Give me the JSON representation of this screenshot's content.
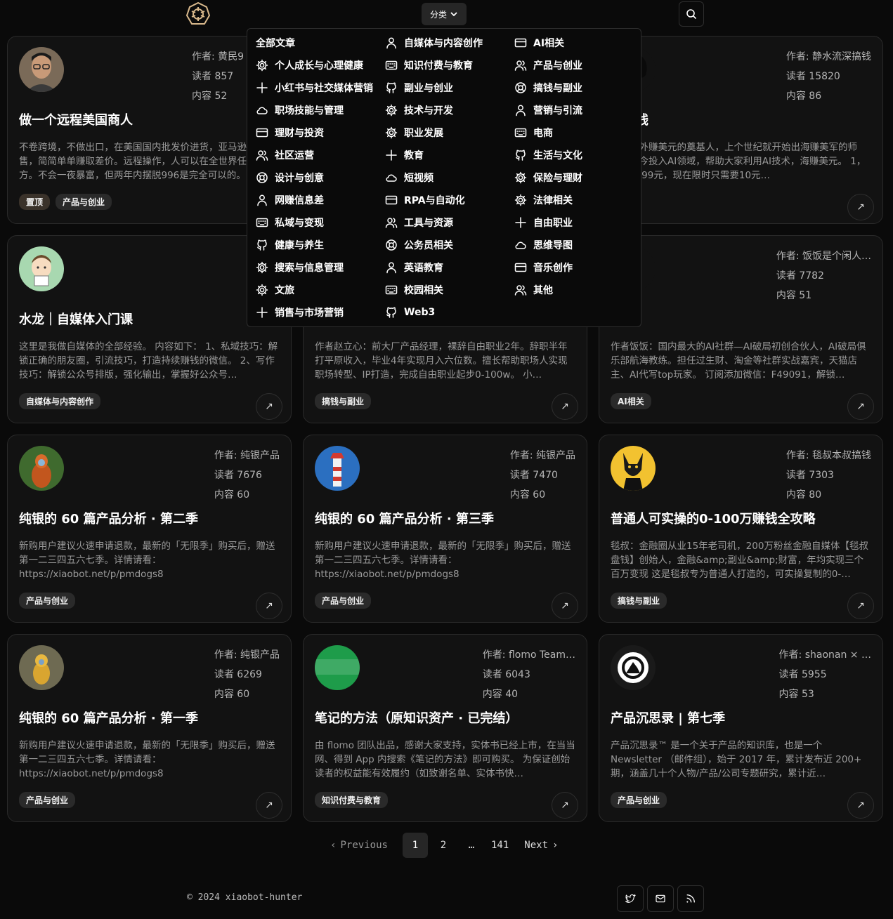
{
  "nav": {
    "category_label": "分类"
  },
  "categories": [
    [
      "全部文章",
      "个人成长与心理健康",
      "小红书与社交媒体营销",
      "职场技能与管理",
      "理财与投资",
      "社区运营",
      "设计与创意",
      "网赚信息差",
      "私域与变现",
      "健康与养生",
      "搜索与信息管理",
      "文旅",
      "销售与市场营销"
    ],
    [
      "自媒体与内容创作",
      "知识付费与教育",
      "副业与创业",
      "技术与开发",
      "职业发展",
      "教育",
      "短视频",
      "RPA与自动化",
      "工具与资源",
      "公务员相关",
      "英语教育",
      "校园相关",
      "Web3"
    ],
    [
      "AI相关",
      "产品与创业",
      "搞钱与副业",
      "营销与引流",
      "电商",
      "生活与文化",
      "保险与理财",
      "法律相关",
      "自由职业",
      "思维导图",
      "音乐创作",
      "其他"
    ]
  ],
  "category_icons": [
    [
      "none",
      "gear-icon",
      "plus-icon",
      "cloud-icon",
      "card-icon",
      "users-icon",
      "lifebuoy-icon",
      "user-icon",
      "keyboard-icon",
      "github-icon",
      "gear-icon",
      "gear-icon",
      "plus-icon"
    ],
    [
      "user-icon",
      "keyboard-icon",
      "github-icon",
      "gear-icon",
      "gear-icon",
      "plus-icon",
      "cloud-icon",
      "card-icon",
      "users-icon",
      "lifebuoy-icon",
      "user-icon",
      "keyboard-icon",
      "github-icon"
    ],
    [
      "card-icon",
      "users-icon",
      "lifebuoy-icon",
      "user-icon",
      "keyboard-icon",
      "github-icon",
      "gear-icon",
      "gear-icon",
      "plus-icon",
      "cloud-icon",
      "card-icon",
      "users-icon"
    ]
  ],
  "labels": {
    "author": "作者:",
    "readers": "读者",
    "content": "内容",
    "arrow": "↗"
  },
  "cards": [
    {
      "author": "黄民9",
      "readers": "857",
      "content": "52",
      "title": "做一个远程美国商人",
      "desc": "不卷跨境，不做出口，在美国国内批发价进货，亚马逊价销售，简简单单赚取差价。远程操作，人可以在全世界任何地方。不会一夜暴富，但两年内摆脱996是完全可以的。",
      "tags": [
        "置顶",
        "产品与创业"
      ]
    },
    {
      "author": "",
      "readers": "",
      "content": "",
      "title": "",
      "desc": "",
      "tags": []
    },
    {
      "author": "静水流深搞钱",
      "readers": "15820",
      "content": "86",
      "title": "外赚钱",
      "desc": "深，国外赚美元的奠基人，上个世纪就开始出海赚美军的师弟，如今投入AI领域，帮助大家利用AI技术，海赚美元。 1，原价9999元，现在限时只需要10元…",
      "tags": [
        "副业"
      ]
    },
    {
      "author": "",
      "readers": "",
      "content": "",
      "title": "水龙｜自媒体入门课",
      "desc": "这里是我做自媒体的全部经验。 内容如下： 1、私域技巧：解锁正确的朋友圈，引流技巧，打造持续赚钱的微信。 2、写作技巧：解锁公众号排版，强化输出，掌握好公众号…",
      "tags": [
        "自媒体与内容创作"
      ]
    },
    {
      "author": "",
      "readers": "",
      "content": "",
      "title": "",
      "desc": "作者赵立心：前大厂产品经理，裸辞自由职业2年。辞职半年打平原收入，毕业4年实现月入六位数。擅长帮助职场人实现职场转型、IP打造，完成自由职业起步0-100w。 小…",
      "tags": [
        "搞钱与副业"
      ]
    },
    {
      "author": "饭饭是个闲人…",
      "readers": "7782",
      "content": "51",
      "title": "写",
      "desc": "作者饭饭：国内最大的AI社群—AI破局初创合伙人，AI破局俱乐部航海教练。担任过生财、淘金等社群实战嘉宾，天猫店主、AI代写top玩家。 订阅添加微信：F49091，解锁…",
      "tags": [
        "AI相关"
      ]
    },
    {
      "author": "纯银产品",
      "readers": "7676",
      "content": "60",
      "title": "纯银的 60 篇产品分析 · 第二季",
      "desc": "新购用户建议火速申请退款，最新的「无限季」购买后，赠送第一二三四五六七季。详情请看： https://xiaobot.net/p/pmdogs8",
      "tags": [
        "产品与创业"
      ]
    },
    {
      "author": "纯银产品",
      "readers": "7470",
      "content": "60",
      "title": "纯银的 60 篇产品分析 · 第三季",
      "desc": "新购用户建议火速申请退款，最新的「无限季」购买后，赠送第一二三四五六七季。详情请看： https://xiaobot.net/p/pmdogs8",
      "tags": [
        "产品与创业"
      ]
    },
    {
      "author": "毯叔本叔搞钱",
      "readers": "7303",
      "content": "80",
      "title": "普通人可实操的0-100万赚钱全攻略",
      "desc": "毯叔：金融圈从业15年老司机，200万粉丝金融自媒体【毯叔盘钱】创始人，金融&amp;副业&amp;财富，年均实现三个百万变现 这是毯叔专为普通人打造的，可实操复制的0-…",
      "tags": [
        "搞钱与副业"
      ]
    },
    {
      "author": "纯银产品",
      "readers": "6269",
      "content": "60",
      "title": "纯银的 60 篇产品分析 · 第一季",
      "desc": "新购用户建议火速申请退款，最新的「无限季」购买后，赠送第一二三四五六七季。详情请看： https://xiaobot.net/p/pmdogs8",
      "tags": [
        "产品与创业"
      ]
    },
    {
      "author": "flomo Team…",
      "readers": "6043",
      "content": "40",
      "title": "笔记的方法（原知识资产 · 已完结）",
      "desc": "由 flomo 团队出品，感谢大家支持，实体书已经上市，在当当网、得到 App 内搜索《笔记的方法》即可购买。 为保证创始读者的权益能有效履约（如致谢名单、实体书快…",
      "tags": [
        "知识付费与教育"
      ]
    },
    {
      "author": "shaonan × …",
      "readers": "5955",
      "content": "53",
      "title": "产品沉思录 | 第七季",
      "desc": "产品沉思录™ 是一个关于产品的知识库，也是一个 Newsletter （邮件组），始于 2017 年，累计发布近 200+ 期，涵盖几十个人物/产品/公司专题研究，累计近…",
      "tags": [
        "产品与创业"
      ]
    }
  ],
  "pagination": {
    "previous": "Previous",
    "pages": [
      "1",
      "2"
    ],
    "ellipsis": "…",
    "last": "141",
    "next": "Next",
    "current": "1"
  },
  "footer": {
    "copyright": "© 2024 xiaobot-hunter"
  },
  "colors": {
    "background": "#0a0a0a",
    "card": "#121212",
    "border": "#2a2a2a",
    "tag": "#2a2a2a",
    "logo": "#d9b98c"
  }
}
